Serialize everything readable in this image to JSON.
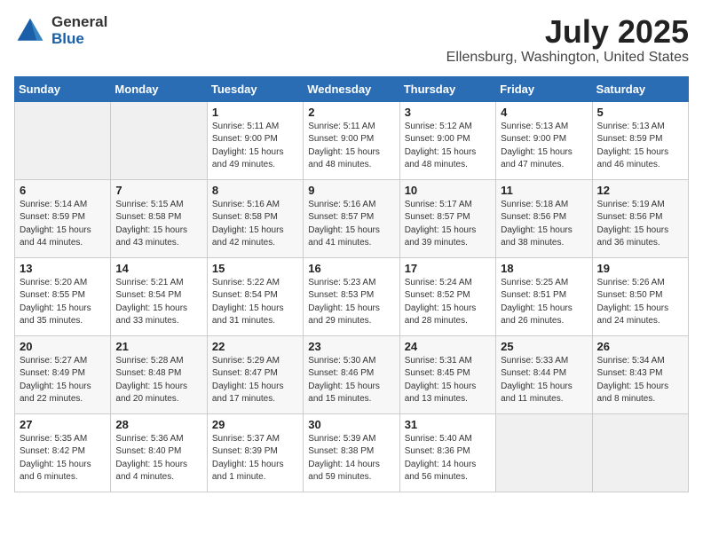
{
  "header": {
    "logo_general": "General",
    "logo_blue": "Blue",
    "month_title": "July 2025",
    "location": "Ellensburg, Washington, United States"
  },
  "days_of_week": [
    "Sunday",
    "Monday",
    "Tuesday",
    "Wednesday",
    "Thursday",
    "Friday",
    "Saturday"
  ],
  "weeks": [
    [
      {
        "day": "",
        "info": ""
      },
      {
        "day": "",
        "info": ""
      },
      {
        "day": "1",
        "info": "Sunrise: 5:11 AM\nSunset: 9:00 PM\nDaylight: 15 hours and 49 minutes."
      },
      {
        "day": "2",
        "info": "Sunrise: 5:11 AM\nSunset: 9:00 PM\nDaylight: 15 hours and 48 minutes."
      },
      {
        "day": "3",
        "info": "Sunrise: 5:12 AM\nSunset: 9:00 PM\nDaylight: 15 hours and 48 minutes."
      },
      {
        "day": "4",
        "info": "Sunrise: 5:13 AM\nSunset: 9:00 PM\nDaylight: 15 hours and 47 minutes."
      },
      {
        "day": "5",
        "info": "Sunrise: 5:13 AM\nSunset: 8:59 PM\nDaylight: 15 hours and 46 minutes."
      }
    ],
    [
      {
        "day": "6",
        "info": "Sunrise: 5:14 AM\nSunset: 8:59 PM\nDaylight: 15 hours and 44 minutes."
      },
      {
        "day": "7",
        "info": "Sunrise: 5:15 AM\nSunset: 8:58 PM\nDaylight: 15 hours and 43 minutes."
      },
      {
        "day": "8",
        "info": "Sunrise: 5:16 AM\nSunset: 8:58 PM\nDaylight: 15 hours and 42 minutes."
      },
      {
        "day": "9",
        "info": "Sunrise: 5:16 AM\nSunset: 8:57 PM\nDaylight: 15 hours and 41 minutes."
      },
      {
        "day": "10",
        "info": "Sunrise: 5:17 AM\nSunset: 8:57 PM\nDaylight: 15 hours and 39 minutes."
      },
      {
        "day": "11",
        "info": "Sunrise: 5:18 AM\nSunset: 8:56 PM\nDaylight: 15 hours and 38 minutes."
      },
      {
        "day": "12",
        "info": "Sunrise: 5:19 AM\nSunset: 8:56 PM\nDaylight: 15 hours and 36 minutes."
      }
    ],
    [
      {
        "day": "13",
        "info": "Sunrise: 5:20 AM\nSunset: 8:55 PM\nDaylight: 15 hours and 35 minutes."
      },
      {
        "day": "14",
        "info": "Sunrise: 5:21 AM\nSunset: 8:54 PM\nDaylight: 15 hours and 33 minutes."
      },
      {
        "day": "15",
        "info": "Sunrise: 5:22 AM\nSunset: 8:54 PM\nDaylight: 15 hours and 31 minutes."
      },
      {
        "day": "16",
        "info": "Sunrise: 5:23 AM\nSunset: 8:53 PM\nDaylight: 15 hours and 29 minutes."
      },
      {
        "day": "17",
        "info": "Sunrise: 5:24 AM\nSunset: 8:52 PM\nDaylight: 15 hours and 28 minutes."
      },
      {
        "day": "18",
        "info": "Sunrise: 5:25 AM\nSunset: 8:51 PM\nDaylight: 15 hours and 26 minutes."
      },
      {
        "day": "19",
        "info": "Sunrise: 5:26 AM\nSunset: 8:50 PM\nDaylight: 15 hours and 24 minutes."
      }
    ],
    [
      {
        "day": "20",
        "info": "Sunrise: 5:27 AM\nSunset: 8:49 PM\nDaylight: 15 hours and 22 minutes."
      },
      {
        "day": "21",
        "info": "Sunrise: 5:28 AM\nSunset: 8:48 PM\nDaylight: 15 hours and 20 minutes."
      },
      {
        "day": "22",
        "info": "Sunrise: 5:29 AM\nSunset: 8:47 PM\nDaylight: 15 hours and 17 minutes."
      },
      {
        "day": "23",
        "info": "Sunrise: 5:30 AM\nSunset: 8:46 PM\nDaylight: 15 hours and 15 minutes."
      },
      {
        "day": "24",
        "info": "Sunrise: 5:31 AM\nSunset: 8:45 PM\nDaylight: 15 hours and 13 minutes."
      },
      {
        "day": "25",
        "info": "Sunrise: 5:33 AM\nSunset: 8:44 PM\nDaylight: 15 hours and 11 minutes."
      },
      {
        "day": "26",
        "info": "Sunrise: 5:34 AM\nSunset: 8:43 PM\nDaylight: 15 hours and 8 minutes."
      }
    ],
    [
      {
        "day": "27",
        "info": "Sunrise: 5:35 AM\nSunset: 8:42 PM\nDaylight: 15 hours and 6 minutes."
      },
      {
        "day": "28",
        "info": "Sunrise: 5:36 AM\nSunset: 8:40 PM\nDaylight: 15 hours and 4 minutes."
      },
      {
        "day": "29",
        "info": "Sunrise: 5:37 AM\nSunset: 8:39 PM\nDaylight: 15 hours and 1 minute."
      },
      {
        "day": "30",
        "info": "Sunrise: 5:39 AM\nSunset: 8:38 PM\nDaylight: 14 hours and 59 minutes."
      },
      {
        "day": "31",
        "info": "Sunrise: 5:40 AM\nSunset: 8:36 PM\nDaylight: 14 hours and 56 minutes."
      },
      {
        "day": "",
        "info": ""
      },
      {
        "day": "",
        "info": ""
      }
    ]
  ]
}
